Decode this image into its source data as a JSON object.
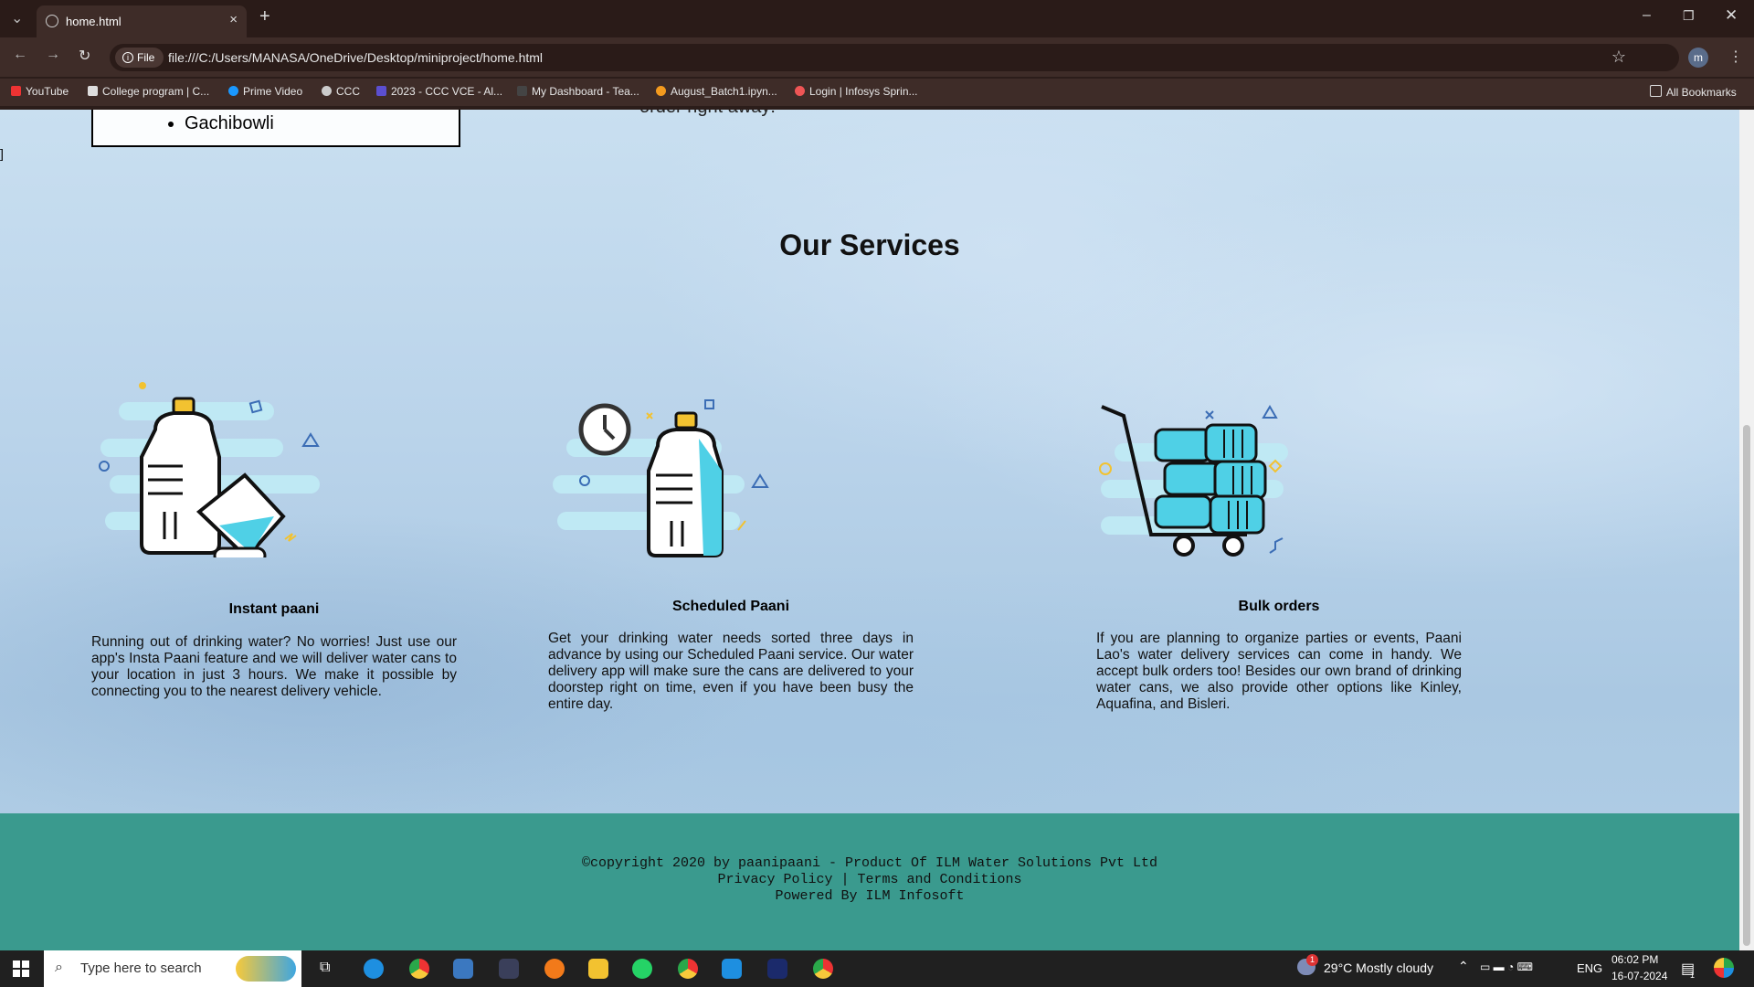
{
  "browser": {
    "tab_title": "home.html",
    "new_tab": "+",
    "file_badge": "File",
    "url": "file:///C:/Users/MANASA/OneDrive/Desktop/miniproject/home.html",
    "profile": "m",
    "bookmarks": [
      "YouTube",
      "College program | C...",
      "Prime Video",
      "CCC",
      "2023 - CCC VCE - Al...",
      "My Dashboard - Tea...",
      "August_Batch1.ipyn...",
      "Login | Infosys Sprin..."
    ],
    "all_bookmarks": "All Bookmarks"
  },
  "page": {
    "location_item": "Gachibowli",
    "order_text": "order right away!",
    "section_title": "Our Services",
    "services": [
      {
        "title": "Instant paani",
        "text": "Running out of drinking water? No worries! Just use our app's Insta Paani feature and we will deliver water cans to your location in just 3 hours. We make it possible by connecting you to the nearest delivery vehicle."
      },
      {
        "title": "Scheduled Paani",
        "text": "Get your drinking water needs sorted three days in advance by using our Scheduled Paani service. Our water delivery app will make sure the cans are delivered to your doorstep right on time, even if you have been busy the entire day."
      },
      {
        "title": "Bulk orders",
        "text": "If you are planning to organize parties or events, Paani Lao's water delivery services can come in handy. We accept bulk orders too! Besides our own brand of drinking water cans, we also provide other options like Kinley, Aquafina, and Bisleri."
      }
    ],
    "footer": {
      "copyright": "©copyright 2020 by paanipaani - Product Of ILM Water Solutions Pvt Ltd",
      "links": "Privacy Policy | Terms and Conditions",
      "powered": "Powered By ILM Infosoft"
    }
  },
  "taskbar": {
    "search_placeholder": "Type here to search",
    "weather": "29°C  Mostly cloudy",
    "lang": "ENG",
    "time": "06:02 PM",
    "date": "16-07-2024",
    "weather_badge": "1",
    "notif_badge": "1"
  },
  "colors": {
    "footer": "#3a9a8e",
    "accent_cyan": "#4fd0e6",
    "chrome": "#2a1b18"
  }
}
